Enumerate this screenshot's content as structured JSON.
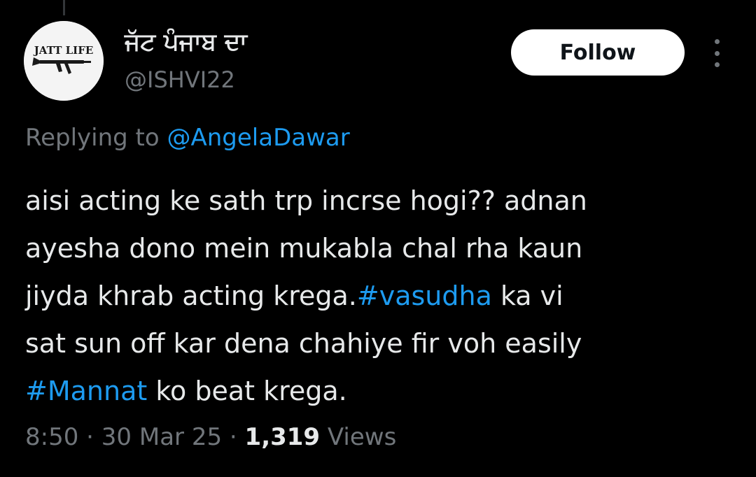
{
  "author": {
    "display_name": "ਜੱਟ ਪੰਜਾਬ ਦਾ",
    "handle": "@ISHVI22",
    "avatar_text": "JATT LIFE"
  },
  "follow_label": "Follow",
  "more_icon": "more-vertical-icon",
  "reply": {
    "prefix": "Replying to",
    "mention": "@AngelaDawar"
  },
  "tweet": {
    "line1": "aisi acting ke sath trp incrse hogi?? adnan",
    "line2": "ayesha dono mein mukabla chal rha kaun",
    "line3_pre": "jiyda khrab acting krega.",
    "hashtag1": "#vasudha",
    "line3_post": " ka vi",
    "line4": "sat sun off kar dena chahiye fir voh easily",
    "hashtag2": "#Mannat",
    "line5_post": " ko beat krega."
  },
  "meta": {
    "time": "8:50",
    "sep1": " · ",
    "date": "30 Mar 25",
    "sep2": " · ",
    "views_count": "1,319",
    "views_label": " Views"
  },
  "colors": {
    "background": "#000000",
    "primary_text": "#e7e9ea",
    "secondary_text": "#71767b",
    "link": "#1d9bf0",
    "follow_bg": "#ffffff"
  }
}
